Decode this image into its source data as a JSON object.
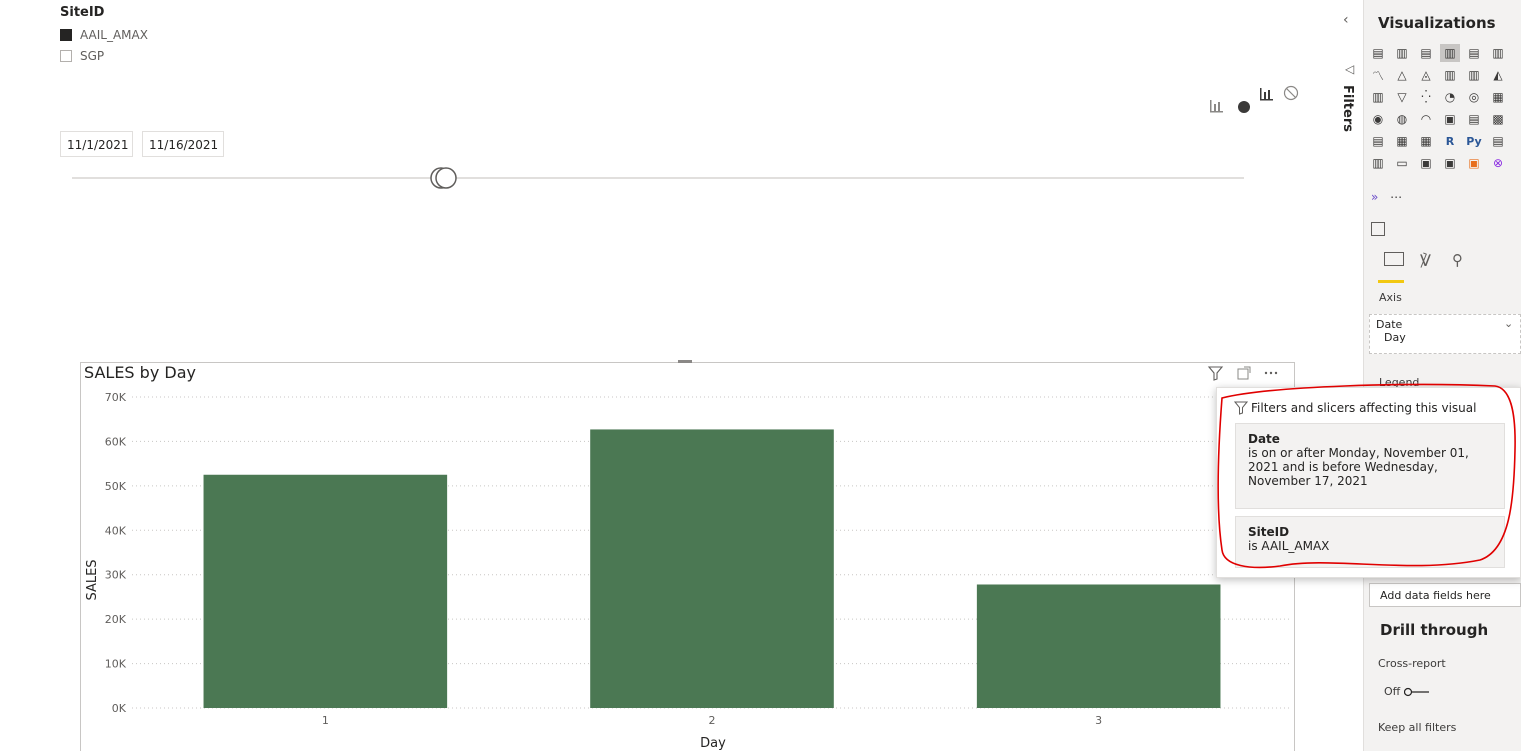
{
  "slicer": {
    "title": "SiteID",
    "items": [
      {
        "label": "AAIL_AMAX",
        "checked": true
      },
      {
        "label": "SGP",
        "checked": false
      }
    ]
  },
  "date_slicer": {
    "start": "11/1/2021",
    "end": "11/16/2021",
    "position": 0.32
  },
  "visual": {
    "title": "SALES by Day"
  },
  "chart_data": {
    "type": "bar",
    "title": "SALES by Day",
    "xlabel": "Day",
    "ylabel": "SALES",
    "categories": [
      "1",
      "2",
      "3"
    ],
    "values": [
      52500,
      62700,
      27800
    ],
    "ylim": [
      0,
      70000
    ],
    "yticks": [
      "0K",
      "10K",
      "20K",
      "30K",
      "40K",
      "50K",
      "60K",
      "70K"
    ],
    "bar_color": "#4b7853",
    "grid": true
  },
  "tooltip": {
    "header": "Filters and slicers affecting this visual",
    "cards": [
      {
        "field": "Date",
        "text": "is on or after Monday, November 01, 2021 and is before Wednesday, November 17, 2021"
      },
      {
        "field": "SiteID",
        "text": "is AAIL_AMAX"
      }
    ]
  },
  "panel": {
    "filters_label": "Filters",
    "title": "Visualizations",
    "axis_label": "Axis",
    "axis_field": "Date",
    "axis_subfield": "Day",
    "legend_label": "Legend",
    "add_fields": "Add data fields here",
    "drill_through": "Drill through",
    "cross_report": "Cross-report",
    "cross_report_state": "Off",
    "keep_filters": "Keep all filters",
    "icons": [
      "stacked-bar-icon",
      "stacked-column-icon",
      "clustered-bar-icon",
      "clustered-column-icon",
      "100-bar-icon",
      "100-column-icon",
      "line-icon",
      "area-icon",
      "stacked-area-icon",
      "line-column-icon",
      "line-clustered-icon",
      "ribbon-icon",
      "waterfall-icon",
      "funnel-icon",
      "scatter-icon",
      "pie-icon",
      "donut-icon",
      "treemap-icon",
      "map-icon",
      "filled-map-icon",
      "gauge-icon",
      "card-icon",
      "multirow-card-icon",
      "kpi-icon",
      "slicer-icon",
      "table-icon",
      "matrix-icon",
      "r-visual-icon",
      "python-visual-icon",
      "key-influencers-icon",
      "decomposition-tree-icon",
      "qa-icon",
      "smart-narrative-icon",
      "paginated-icon",
      "power-apps-icon",
      "power-automate-icon"
    ]
  },
  "colors": {
    "bar": "#4b7853",
    "annotation": "#e00000",
    "accent": "#f2c811"
  }
}
